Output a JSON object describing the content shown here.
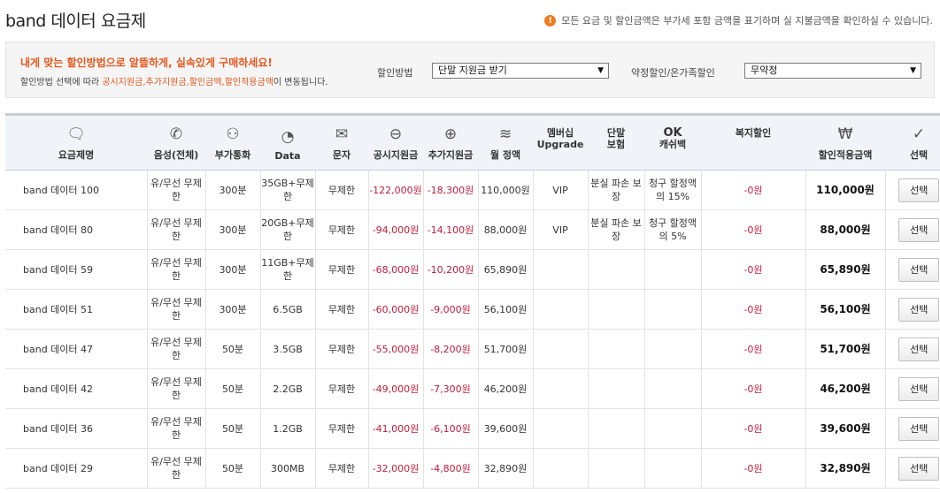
{
  "page": {
    "title": "band 데이터 요금제",
    "notice": "모든 요금 및 할인금액은 부가세 포함 금액을 표기하며 실 지불금액을 확인하실 수 있습니다."
  },
  "filter": {
    "headline": "내게 맞는 할인방법으로 알뜰하게, 실속있게 구매하세요!",
    "desc_prefix": "할인방법 선택에 따라",
    "desc_highlight": "공시지원금,추가지원금,할인금액,할인적용금액",
    "desc_suffix": "이 변동됩니다.",
    "method_label": "할인방법",
    "method_value": "단말 지원금 받기",
    "contract_label": "약정할인/온가족할인",
    "contract_value": "무약정"
  },
  "columns": {
    "plan": "요금제명",
    "voice": "음성(전체)",
    "extra_call": "부가통화",
    "data": "Data",
    "sms": "문자",
    "public_subsidy": "공시지원금",
    "extra_subsidy": "추가지원금",
    "monthly": "월 정액",
    "membership_1": "멤버십",
    "membership_2": "Upgrade",
    "insurance_1": "단말",
    "insurance_2": "보험",
    "cashback_1": "OK",
    "cashback_2": "캐쉬백",
    "welfare": "복지할인",
    "final": "할인적용금액",
    "select": "선택"
  },
  "icons": {
    "plan": "speech-bubble-icon",
    "voice": "phone-icon",
    "extra_call": "video-call-icon",
    "data": "gauge-icon",
    "sms": "envelope-icon",
    "public_subsidy": "coin-stack-minus-icon",
    "extra_subsidy": "coin-stack-plus-icon",
    "monthly": "coin-stack-icon",
    "final": "won-icon",
    "select": "checkmark-icon",
    "notice": "exclamation-icon"
  },
  "colors": {
    "accent": "#e8571c",
    "negative": "#c21d3b"
  },
  "rows": [
    {
      "name": "band 데이터 100",
      "voice": "유/무선 무제한",
      "extra": "300분",
      "data": "35GB+무제한",
      "sms": "무제한",
      "public": "-122,000원",
      "extra_sub": "-18,300원",
      "monthly": "110,000원",
      "membership": "VIP",
      "insurance": "분실 파손 보장",
      "cashback": "청구 할정액의 15%",
      "welfare": "-0원",
      "final": "110,000원",
      "btn": "선택"
    },
    {
      "name": "band 데이터 80",
      "voice": "유/무선 무제한",
      "extra": "300분",
      "data": "20GB+무제한",
      "sms": "무제한",
      "public": "-94,000원",
      "extra_sub": "-14,100원",
      "monthly": "88,000원",
      "membership": "VIP",
      "insurance": "분실 파손 보장",
      "cashback": "청구 할정액의 5%",
      "welfare": "-0원",
      "final": "88,000원",
      "btn": "선택"
    },
    {
      "name": "band 데이터 59",
      "voice": "유/무선 무제한",
      "extra": "300분",
      "data": "11GB+무제한",
      "sms": "무제한",
      "public": "-68,000원",
      "extra_sub": "-10,200원",
      "monthly": "65,890원",
      "membership": "",
      "insurance": "",
      "cashback": "",
      "welfare": "-0원",
      "final": "65,890원",
      "btn": "선택"
    },
    {
      "name": "band 데이터 51",
      "voice": "유/무선 무제한",
      "extra": "300분",
      "data": "6.5GB",
      "sms": "무제한",
      "public": "-60,000원",
      "extra_sub": "-9,000원",
      "monthly": "56,100원",
      "membership": "",
      "insurance": "",
      "cashback": "",
      "welfare": "-0원",
      "final": "56,100원",
      "btn": "선택"
    },
    {
      "name": "band 데이터 47",
      "voice": "유/무선 무제한",
      "extra": "50분",
      "data": "3.5GB",
      "sms": "무제한",
      "public": "-55,000원",
      "extra_sub": "-8,200원",
      "monthly": "51,700원",
      "membership": "",
      "insurance": "",
      "cashback": "",
      "welfare": "-0원",
      "final": "51,700원",
      "btn": "선택"
    },
    {
      "name": "band 데이터 42",
      "voice": "유/무선 무제한",
      "extra": "50분",
      "data": "2.2GB",
      "sms": "무제한",
      "public": "-49,000원",
      "extra_sub": "-7,300원",
      "monthly": "46,200원",
      "membership": "",
      "insurance": "",
      "cashback": "",
      "welfare": "-0원",
      "final": "46,200원",
      "btn": "선택"
    },
    {
      "name": "band 데이터 36",
      "voice": "유/무선 무제한",
      "extra": "50분",
      "data": "1.2GB",
      "sms": "무제한",
      "public": "-41,000원",
      "extra_sub": "-6,100원",
      "monthly": "39,600원",
      "membership": "",
      "insurance": "",
      "cashback": "",
      "welfare": "-0원",
      "final": "39,600원",
      "btn": "선택"
    },
    {
      "name": "band 데이터 29",
      "voice": "유/무선 무제한",
      "extra": "50분",
      "data": "300MB",
      "sms": "무제한",
      "public": "-32,000원",
      "extra_sub": "-4,800원",
      "monthly": "32,890원",
      "membership": "",
      "insurance": "",
      "cashback": "",
      "welfare": "-0원",
      "final": "32,890원",
      "btn": "선택"
    }
  ]
}
